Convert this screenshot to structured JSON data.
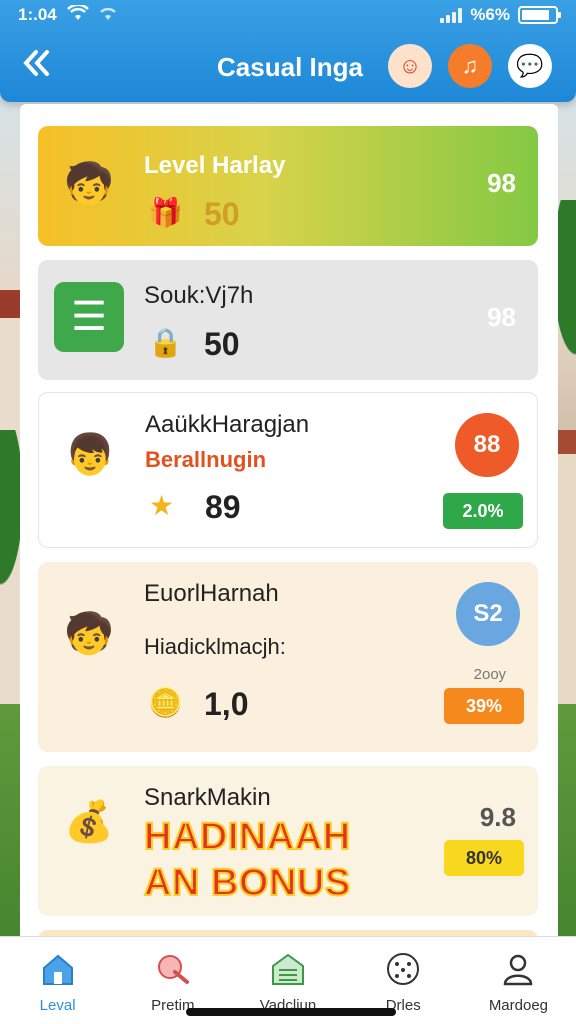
{
  "status_bar": {
    "time": "1:.04",
    "battery": "%6%",
    "battery_level": 0.85
  },
  "header": {
    "title": "Casual Inga",
    "back_icon": "double-chevron-left-icon",
    "icons": [
      "avatar-icon",
      "music-note-icon",
      "chat-bubble-icon"
    ]
  },
  "cards": [
    {
      "title": "Level Harlay",
      "score": "50",
      "right_value": "98",
      "icon": "hero-character-icon",
      "score_icon": "gift-box-icon"
    },
    {
      "title": "Souk:Vj7h",
      "score": "50",
      "right_value": "98",
      "icon": "notepad-icon",
      "score_icon": "lock-icon"
    },
    {
      "title": "AaükkHaragjan",
      "subtitle": "Berallnugin",
      "score": "89",
      "badge": "88",
      "percent": "2.0%",
      "icon": "boy-reading-icon",
      "score_icon": "star-icon"
    },
    {
      "title": "EuorlHarnah",
      "subtitle": "Hiadicklmacjh:",
      "score": "1,0",
      "badge": "S2",
      "note": "2oоу",
      "percent": "39%",
      "icon": "child-icon",
      "score_icon": "coin-stack-icon"
    },
    {
      "title": "SnarkMakin",
      "score_value": "9.8",
      "percent": "80%",
      "bonus_line1": "HADINAAH",
      "bonus_line2": "AN BONUS",
      "icon": "gold-coins-icon"
    }
  ],
  "colors": {
    "appbar": "#1e88d8",
    "badge_red": "#ee5a28",
    "badge_blue": "#6aa6e0",
    "pill_green": "#2fa84a",
    "pill_orange": "#f5891e",
    "pill_yellow": "#f7d81e"
  },
  "nav": [
    {
      "label": "Leval",
      "icon": "home-icon",
      "active": true
    },
    {
      "label": "Pretim",
      "icon": "pill-icon",
      "active": false
    },
    {
      "label": "Vadcliun",
      "icon": "garage-icon",
      "active": false
    },
    {
      "label": "Drles",
      "icon": "dice-face-icon",
      "active": false
    },
    {
      "label": "Mardoeg",
      "icon": "user-profile-icon",
      "active": false
    }
  ]
}
